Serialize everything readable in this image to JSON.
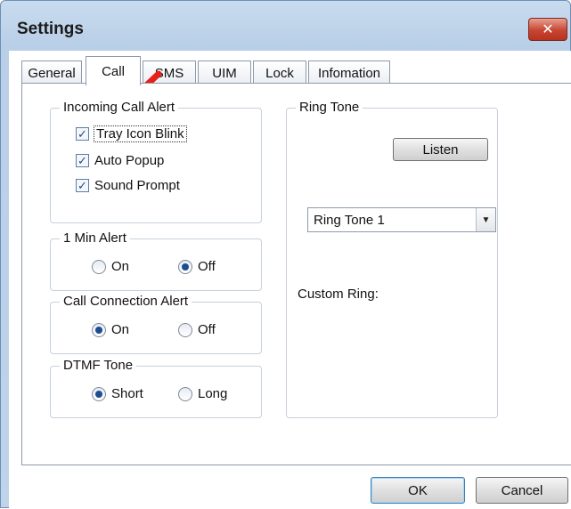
{
  "window": {
    "title": "Settings",
    "close_glyph": "✕"
  },
  "tabs": [
    {
      "label": "General",
      "active": false
    },
    {
      "label": "Call",
      "active": true
    },
    {
      "label": "SMS",
      "active": false
    },
    {
      "label": "UIM",
      "active": false
    },
    {
      "label": "Lock",
      "active": false
    },
    {
      "label": "Infomation",
      "active": false
    }
  ],
  "incoming_call_alert": {
    "title": "Incoming Call Alert",
    "options": [
      {
        "label": "Tray Icon Blink",
        "checked": true
      },
      {
        "label": "Auto Popup",
        "checked": true
      },
      {
        "label": "Sound Prompt",
        "checked": true
      }
    ]
  },
  "one_min_alert": {
    "title": "1 Min Alert",
    "on_label": "On",
    "off_label": "Off",
    "selected": "off"
  },
  "call_connection_alert": {
    "title": "Call Connection Alert",
    "on_label": "On",
    "off_label": "Off",
    "selected": "on"
  },
  "dtmf_tone": {
    "title": "DTMF Tone",
    "short_label": "Short",
    "long_label": "Long",
    "selected": "short"
  },
  "ring_tone": {
    "title": "Ring Tone",
    "listen_label": "Listen",
    "selected_value": "Ring Tone 1",
    "custom_ring_label": "Custom Ring:"
  },
  "footer": {
    "ok_label": "OK",
    "cancel_label": "Cancel"
  },
  "colors": {
    "annotation_arrow": "#e8201a",
    "radio_dot": "#1d4d91",
    "title_bar": "#bfd3ea"
  },
  "icons": {
    "check": "✓",
    "dropdown": "▼"
  }
}
